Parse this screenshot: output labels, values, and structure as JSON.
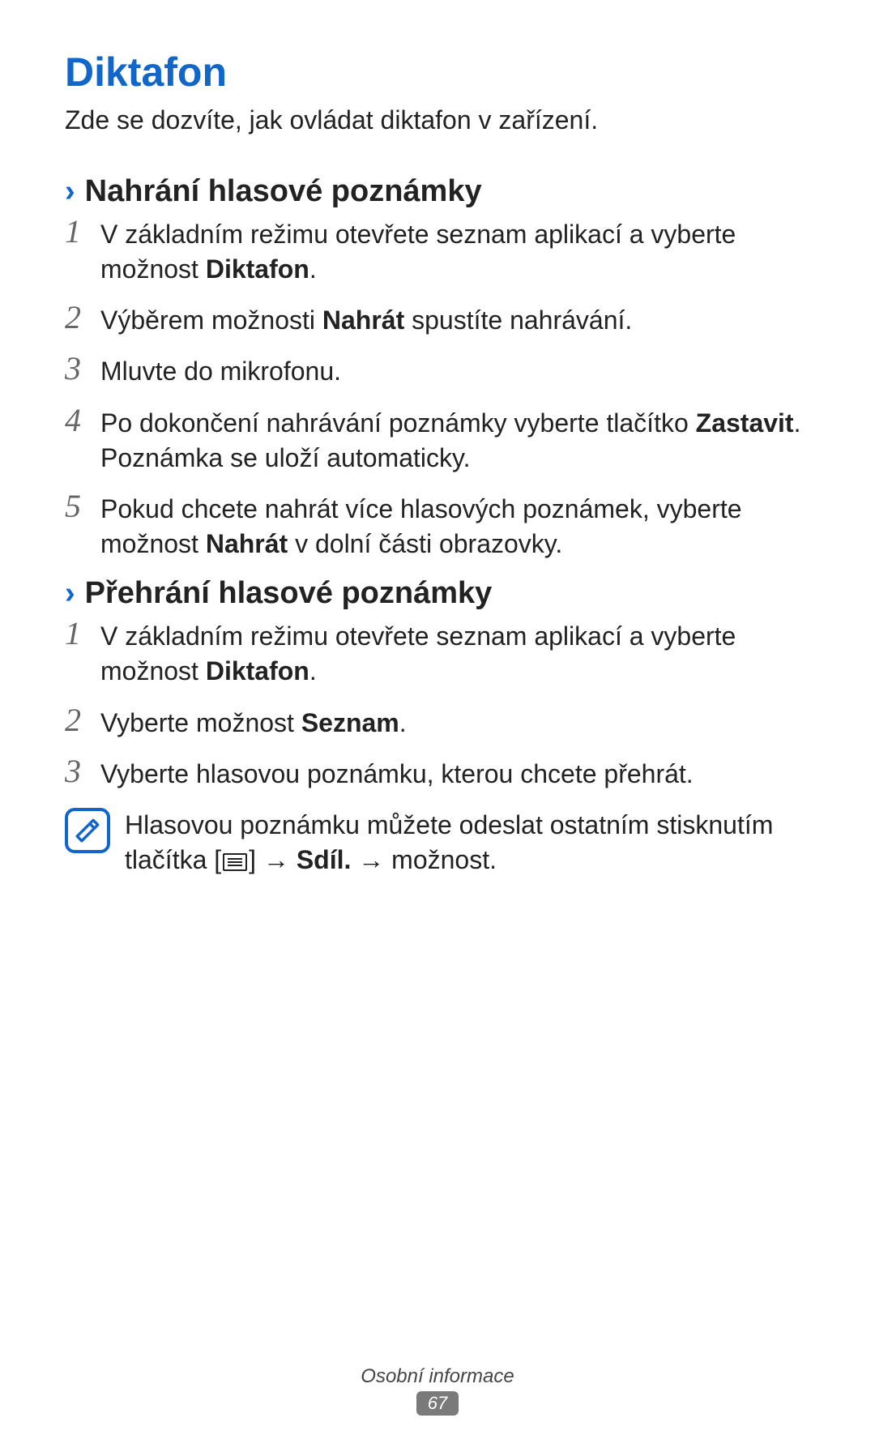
{
  "title": "Diktafon",
  "intro": "Zde se dozvíte, jak ovládat diktafon v zařízení.",
  "section1": {
    "heading": "Nahrání hlasové poznámky",
    "steps": {
      "s1a": "V základním režimu otevřete seznam aplikací a vyberte možnost ",
      "s1b": "Diktafon",
      "s1c": ".",
      "s2a": "Výběrem možnosti ",
      "s2b": "Nahrát",
      "s2c": " spustíte nahrávání.",
      "s3": "Mluvte do mikrofonu.",
      "s4a": "Po dokončení nahrávání poznámky vyberte tlačítko ",
      "s4b": "Zastavit",
      "s4c": ". Poznámka se uloží automaticky.",
      "s5a": "Pokud chcete nahrát více hlasových poznámek, vyberte možnost ",
      "s5b": "Nahrát",
      "s5c": " v dolní části obrazovky."
    }
  },
  "section2": {
    "heading": "Přehrání hlasové poznámky",
    "steps": {
      "s1a": "V základním režimu otevřete seznam aplikací a vyberte možnost ",
      "s1b": "Diktafon",
      "s1c": ".",
      "s2a": "Vyberte možnost ",
      "s2b": "Seznam",
      "s2c": ".",
      "s3": "Vyberte hlasovou poznámku, kterou chcete přehrát."
    },
    "note": {
      "a": "Hlasovou poznámku můžete odeslat ostatním stisknutím tlačítka [",
      "b": "] → ",
      "c": "Sdíl.",
      "d": " → možnost."
    }
  },
  "footer": {
    "label": "Osobní informace",
    "page": "67"
  },
  "nums": {
    "n1": "1",
    "n2": "2",
    "n3": "3",
    "n4": "4",
    "n5": "5"
  },
  "chev": "›"
}
